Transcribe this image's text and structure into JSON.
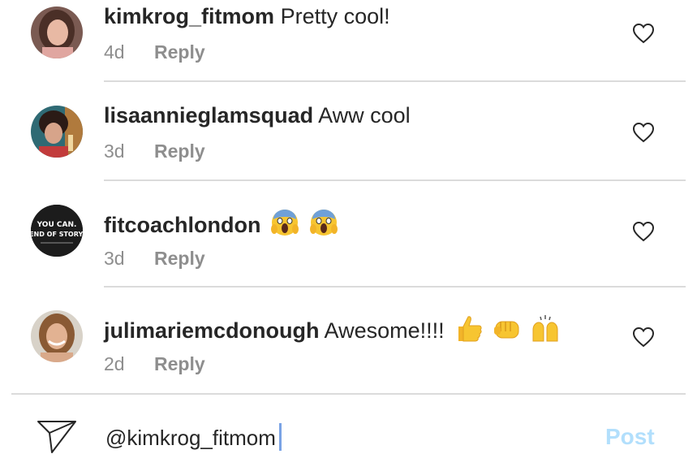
{
  "comments": [
    {
      "username": "kimkrog_fitmom",
      "text": "Pretty cool!",
      "time": "4d",
      "reply_label": "Reply",
      "avatar": "woman-portrait-avatar",
      "emojis": []
    },
    {
      "username": "lisaanniеglamsquad",
      "text": "Aww cool",
      "time": "3d",
      "reply_label": "Reply",
      "avatar": "woman-portrait-avatar",
      "emojis": []
    },
    {
      "username": "fitcoachlondon",
      "text": "",
      "time": "3d",
      "reply_label": "Reply",
      "avatar_text_line1": "YOU CAN.",
      "avatar_text_line2": "END OF STORY.",
      "emojis": [
        "screaming-face-emoji",
        "screaming-face-emoji"
      ]
    },
    {
      "username": "julimariemcdonough",
      "text": "Awesome!!!!",
      "time": "2d",
      "reply_label": "Reply",
      "avatar": "woman-portrait-avatar",
      "emojis": [
        "thumbs-up-emoji",
        "oncoming-fist-emoji",
        "raising-hands-emoji"
      ]
    }
  ],
  "compose": {
    "value": "@kimkrog_fitmom",
    "post_label": "Post",
    "send_icon": "paper-plane-icon"
  },
  "colors": {
    "text": "#262626",
    "meta": "#8e8e8e",
    "divider": "#dbdbdb",
    "post_disabled": "#b2dffc",
    "caret": "#7aa3e5"
  }
}
